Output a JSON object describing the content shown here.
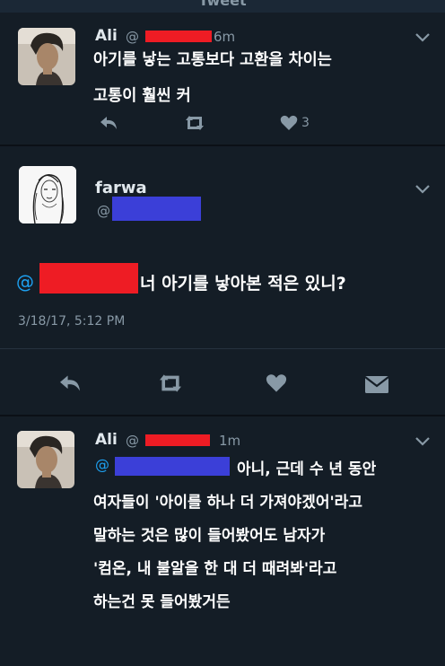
{
  "header": {
    "title": "Tweet"
  },
  "tweet1": {
    "name": "Ali",
    "handle_prefix": "@",
    "time": "6m",
    "lines": [
      "아기를 낳는 고통보다 고환을 차이는",
      "고통이 훨씬 커"
    ],
    "like_count": "3"
  },
  "tweet2": {
    "name": "farwa",
    "handle_prefix": "@",
    "at": "@",
    "text": "너 아기를 낳아본 적은 있니?",
    "timestamp": "3/18/17, 5:12 PM"
  },
  "tweet3": {
    "name": "Ali",
    "handle_prefix": "@",
    "time": "1m",
    "reply_prefix": "@",
    "lines": [
      "아니, 근데 수 년 동안",
      "여자들이 '아이를 하나 더 가져야겠어'라고",
      "말하는 것은 많이 들어봤어도 남자가",
      "'컴온, 내 불알을 한 대 더 때려봐'라고",
      "하는건 못 들어봤거든"
    ]
  },
  "icons": {
    "reply": "reply-icon",
    "retweet": "retweet-icon",
    "like": "heart-icon",
    "dm": "envelope-icon",
    "more": "chevron-down-icon"
  },
  "colors": {
    "background": "#141d26",
    "secondary_text": "#8899a6",
    "link": "#1da1f2",
    "redaction_red": "#ee1c24",
    "redaction_blue": "#3b3fd8"
  }
}
